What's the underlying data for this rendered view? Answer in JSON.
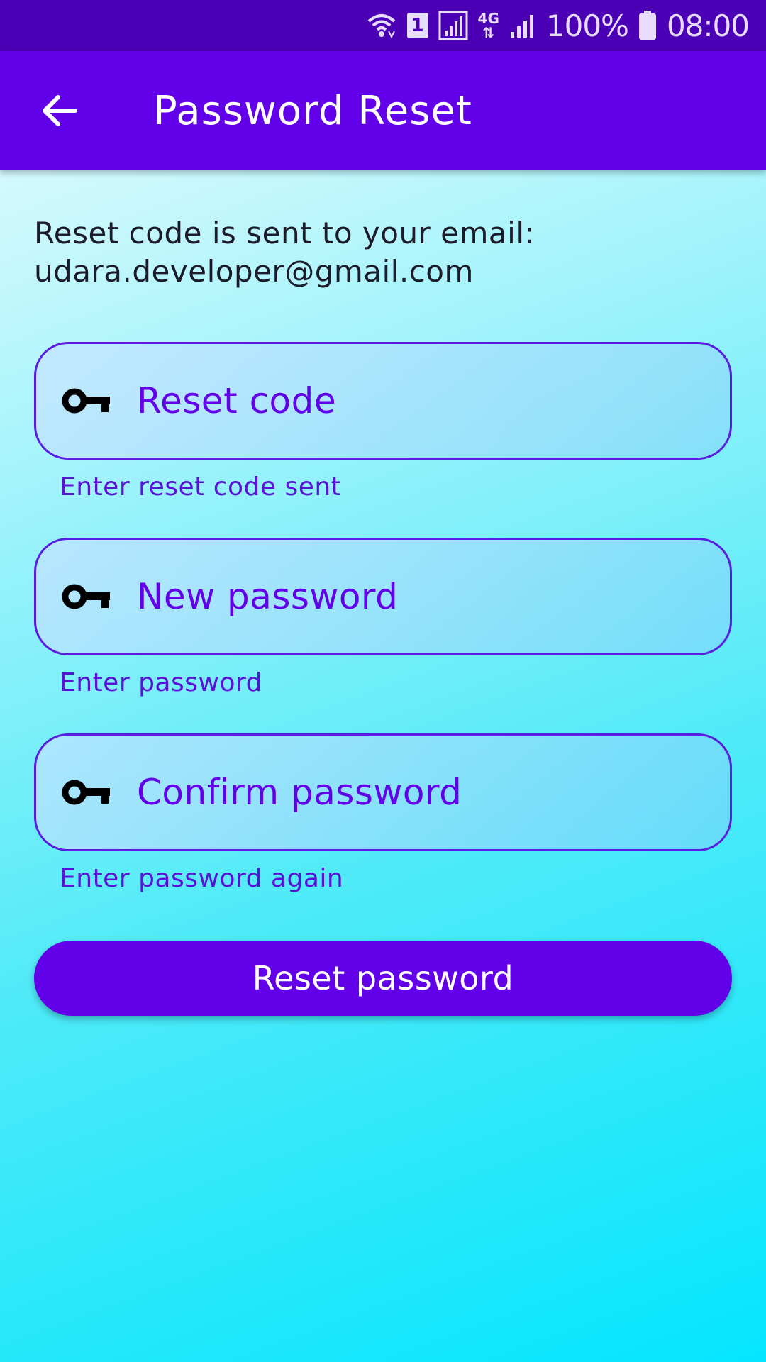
{
  "status_bar": {
    "sim_label": "1",
    "network_label": "4G",
    "battery_percent": "100%",
    "time": "08:00",
    "icons": [
      "wifi-icon",
      "sim-icon",
      "signal-icon",
      "network-4g-icon",
      "signal-icon",
      "battery-icon"
    ]
  },
  "app_bar": {
    "title": "Password Reset",
    "back_icon": "arrow-left-icon"
  },
  "info": {
    "line1": "Reset code is sent to your email:",
    "email": "udara.developer@gmail.com"
  },
  "fields": {
    "reset_code": {
      "placeholder": "Reset code",
      "helper": "Enter reset code sent",
      "icon": "key-icon"
    },
    "new_password": {
      "placeholder": "New password",
      "helper": "Enter password",
      "icon": "key-icon"
    },
    "confirm_password": {
      "placeholder": "Confirm password",
      "helper": "Enter password again",
      "icon": "key-icon"
    }
  },
  "reset_button": {
    "label": "Reset password"
  },
  "colors": {
    "primary": "#6200ea",
    "status_bar": "#4b00b5",
    "background_start": "#eefcff",
    "background_end": "#04e6fe"
  }
}
